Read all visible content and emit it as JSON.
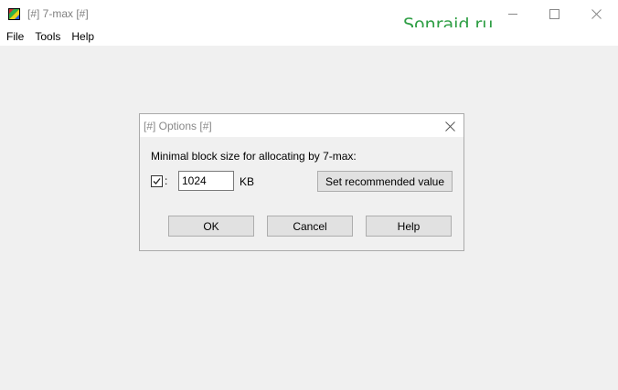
{
  "window": {
    "title": "[#] 7-max [#]",
    "watermark": "Sonraid.ru",
    "icon": "app-icon",
    "controls": [
      "minimize-icon",
      "maximize-icon",
      "close-icon"
    ]
  },
  "menu": {
    "items": [
      {
        "label": "File"
      },
      {
        "label": "Tools"
      },
      {
        "label": "Help"
      }
    ]
  },
  "dialog": {
    "title": "[#] Options [#]",
    "label": "Minimal block size for allocating by 7-max:",
    "checkbox": {
      "checked": true,
      "suffix": ":"
    },
    "size_value": "1024",
    "unit": "KB",
    "recommended_button": "Set recommended value",
    "ok_button": "OK",
    "cancel_button": "Cancel",
    "help_button": "Help"
  },
  "colors": {
    "watermark": "#2e9e44",
    "background": "#f0f0f0",
    "button_face": "#e1e1e1"
  }
}
